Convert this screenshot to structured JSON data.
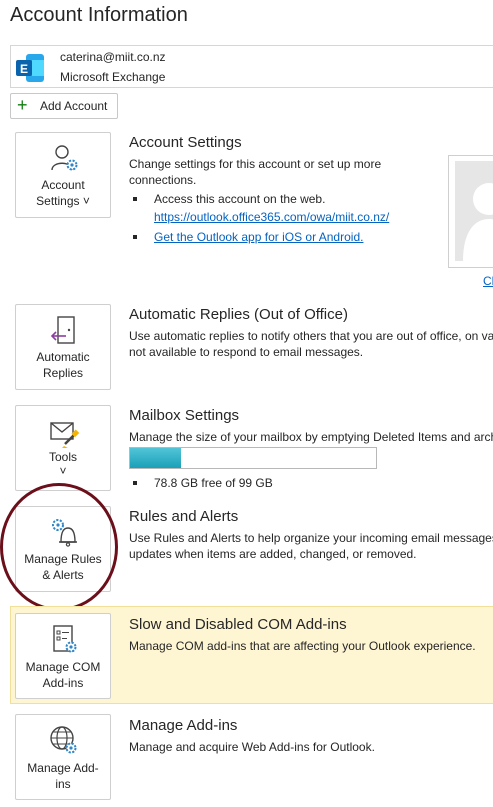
{
  "page": {
    "title": "Account Information"
  },
  "account": {
    "email": "caterina@miit.co.nz",
    "type": "Microsoft Exchange",
    "logo_icon": "exchange-logo-icon"
  },
  "add_account": {
    "label": "Add Account",
    "icon": "plus-icon"
  },
  "account_settings": {
    "button_label_line1": "Account",
    "button_label_line2": "Settings ˅",
    "title": "Account Settings",
    "desc_line1": "Change settings for this account or set up more",
    "desc_line2": "connections.",
    "bullet1": "Access this account on the web.",
    "link1": "https://outlook.office365.com/owa/miit.co.nz/",
    "link2": "Get the Outlook app for iOS or Android.",
    "photo_link": "Ch"
  },
  "automatic_replies": {
    "button_label_line1": "Automatic",
    "button_label_line2": "Replies",
    "title": "Automatic Replies (Out of Office)",
    "desc_line1": "Use automatic replies to notify others that you are out of office, on va",
    "desc_line2": "not available to respond to email messages."
  },
  "mailbox_settings": {
    "button_label_line1": "Tools",
    "button_label_line2": "˅",
    "title": "Mailbox Settings",
    "desc_line1": "Manage the size of your mailbox by emptying Deleted Items and arch",
    "usage_fraction": 0.2064,
    "free_text": "78.8 GB free of 99 GB"
  },
  "rules_alerts": {
    "button_label_line1": "Manage Rules",
    "button_label_line2": "& Alerts",
    "title": "Rules and Alerts",
    "desc_line1": "Use Rules and Alerts to help organize your incoming email messages,",
    "desc_line2": "updates when items are added, changed, or removed."
  },
  "com_addins": {
    "button_label_line1": "Manage COM",
    "button_label_line2": "Add-ins",
    "title": "Slow and Disabled COM Add-ins",
    "desc_line1": "Manage COM add-ins that are affecting your Outlook experience."
  },
  "manage_addins": {
    "button_label_line1": "Manage Add-",
    "button_label_line2": "ins",
    "title": "Manage Add-ins",
    "desc_line1": "Manage and acquire Web Add-ins for Outlook."
  },
  "colors": {
    "accent": "#0563c1",
    "exchange_blue": "#0078d4",
    "highlight_bg": "#fef5d3",
    "progress_fill": "#1aa0b8",
    "annotation_circle": "#6b0f1a"
  }
}
